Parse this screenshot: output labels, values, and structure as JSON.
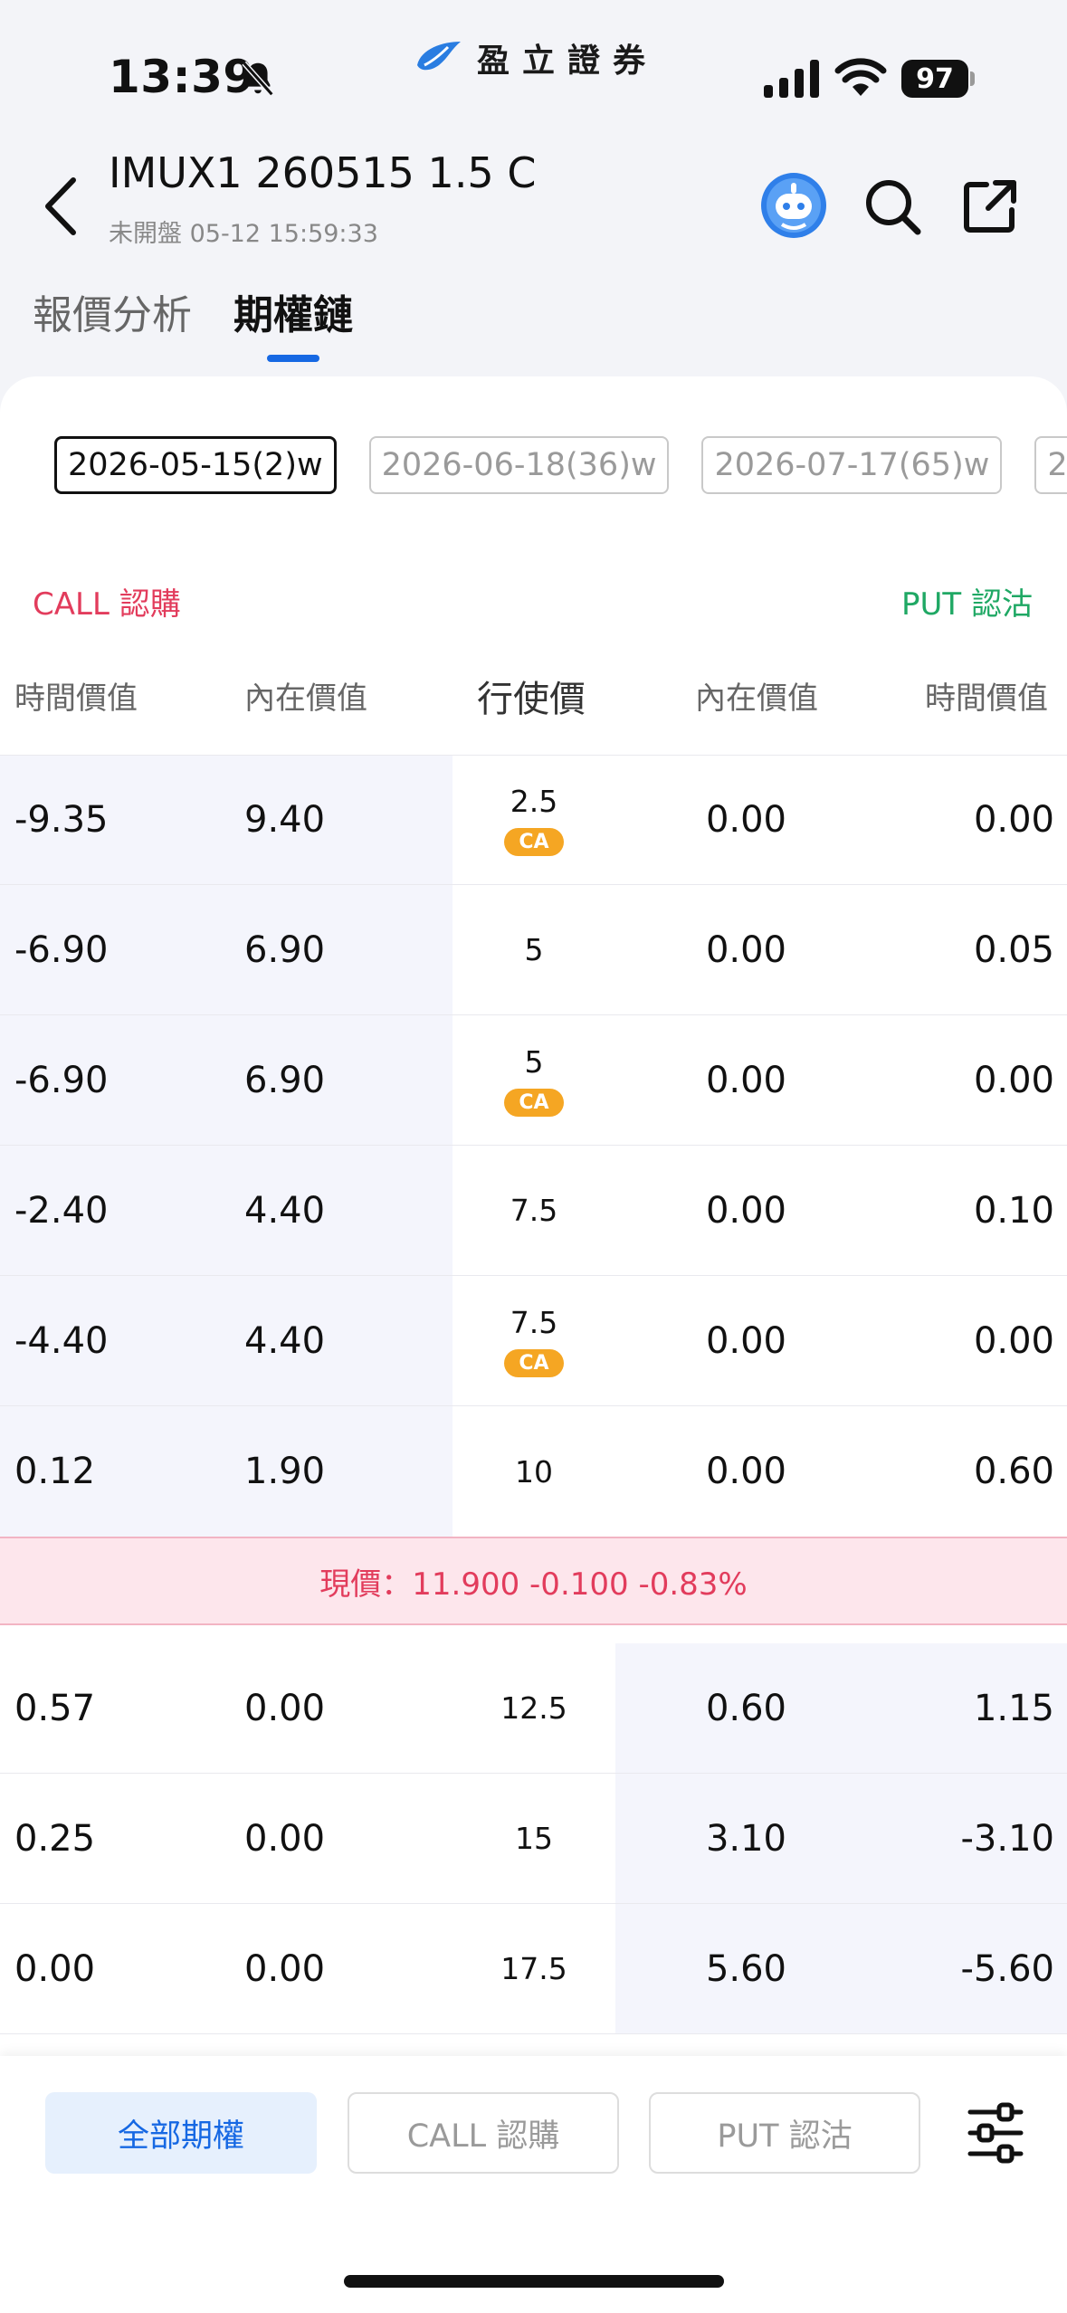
{
  "status_bar": {
    "time": "13:39",
    "battery": "97"
  },
  "brand": {
    "name": "盈立證券"
  },
  "header": {
    "title": "IMUX1 260515 1.5 C",
    "subtitle": "未開盤 05-12 15:59:33"
  },
  "tabs": [
    {
      "label": "報價分析",
      "active": false
    },
    {
      "label": "期權鏈",
      "active": true
    }
  ],
  "expiry_dates": [
    {
      "label": "2026-05-15(2)w",
      "active": true
    },
    {
      "label": "2026-06-18(36)w",
      "active": false
    },
    {
      "label": "2026-07-17(65)w",
      "active": false
    },
    {
      "label": "2",
      "active": false
    }
  ],
  "side_labels": {
    "call": "CALL 認購",
    "put": "PUT 認沽"
  },
  "columns": {
    "call_time_value": "時間價值",
    "call_intrinsic": "內在價值",
    "strike": "行使價",
    "put_intrinsic": "內在價值",
    "put_time_value": "時間價值"
  },
  "rows_above": [
    {
      "call_tv": "-9.35",
      "call_iv": "9.40",
      "strike": "2.5",
      "badge": "CA",
      "put_iv": "0.00",
      "put_tv": "0.00"
    },
    {
      "call_tv": "-6.90",
      "call_iv": "6.90",
      "strike": "5",
      "badge": "",
      "put_iv": "0.00",
      "put_tv": "0.05"
    },
    {
      "call_tv": "-6.90",
      "call_iv": "6.90",
      "strike": "5",
      "badge": "CA",
      "put_iv": "0.00",
      "put_tv": "0.00"
    },
    {
      "call_tv": "-2.40",
      "call_iv": "4.40",
      "strike": "7.5",
      "badge": "",
      "put_iv": "0.00",
      "put_tv": "0.10"
    },
    {
      "call_tv": "-4.40",
      "call_iv": "4.40",
      "strike": "7.5",
      "badge": "CA",
      "put_iv": "0.00",
      "put_tv": "0.00"
    },
    {
      "call_tv": "0.12",
      "call_iv": "1.90",
      "strike": "10",
      "badge": "",
      "put_iv": "0.00",
      "put_tv": "0.60"
    }
  ],
  "current_price": {
    "text": "現價：11.900 -0.100 -0.83%"
  },
  "rows_below": [
    {
      "call_tv": "0.57",
      "call_iv": "0.00",
      "strike": "12.5",
      "badge": "",
      "put_iv": "0.60",
      "put_tv": "1.15"
    },
    {
      "call_tv": "0.25",
      "call_iv": "0.00",
      "strike": "15",
      "badge": "",
      "put_iv": "3.10",
      "put_tv": "-3.10"
    },
    {
      "call_tv": "0.00",
      "call_iv": "0.00",
      "strike": "17.5",
      "badge": "",
      "put_iv": "5.60",
      "put_tv": "-5.60"
    }
  ],
  "filters": {
    "all": "全部期權",
    "call": "CALL 認購",
    "put": "PUT 認沽"
  },
  "colors": {
    "accent": "#1668e3",
    "call": "#e23c5c",
    "put": "#1fa864",
    "ca_badge": "#f5a623"
  }
}
